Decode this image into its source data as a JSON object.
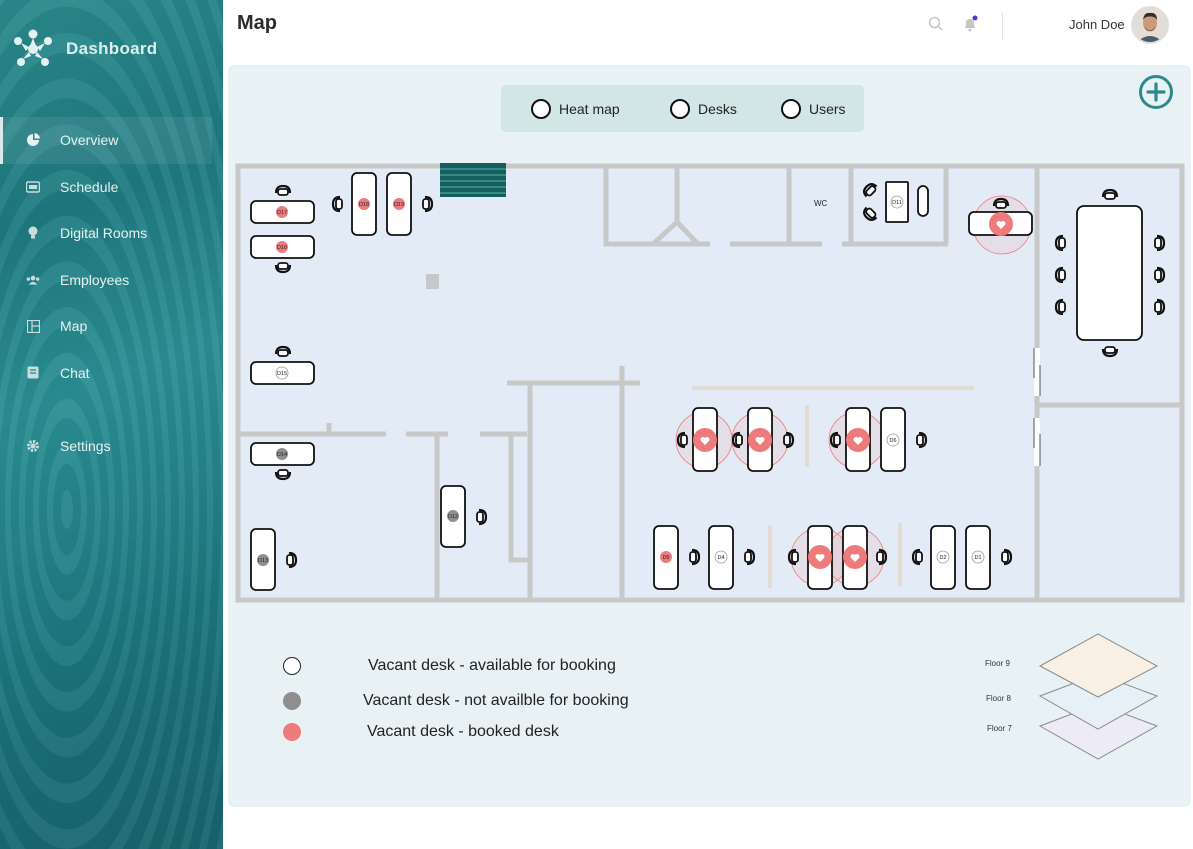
{
  "sidebar": {
    "brand": "Dashboard",
    "items": [
      {
        "label": "Overview",
        "icon": "pie-chart-icon"
      },
      {
        "label": "Schedule",
        "icon": "calendar-icon"
      },
      {
        "label": "Digital Rooms",
        "icon": "lightbulb-icon"
      },
      {
        "label": "Employees",
        "icon": "people-icon"
      },
      {
        "label": "Map",
        "icon": "map-icon"
      },
      {
        "label": "Chat",
        "icon": "chat-icon"
      }
    ],
    "settings_label": "Settings"
  },
  "header": {
    "title": "Map",
    "user_name": "John Doe"
  },
  "toggles": [
    {
      "label": "Heat map"
    },
    {
      "label": "Desks"
    },
    {
      "label": "Users"
    }
  ],
  "floorplan": {
    "wc_label": "WC",
    "desks": {
      "D1": "D1",
      "D2": "D2",
      "D4": "D4",
      "D5": "D5",
      "D6": "D6",
      "D11": "D11",
      "D12": "D12",
      "D13": "D13",
      "D14": "D14",
      "D15": "D15",
      "D16": "D16",
      "D17": "D17",
      "D18": "D18",
      "D19": "D19"
    }
  },
  "legend": [
    {
      "label": "Vacant desk - available for booking",
      "color": "#ffffff"
    },
    {
      "label": "Vacant desk - not availble for booking",
      "color": "#8f8f8f"
    },
    {
      "label": "Vacant desk - booked desk",
      "color": "#ee7b7b"
    }
  ],
  "floors": [
    {
      "label": "Floor 9",
      "color": "#f8efe5"
    },
    {
      "label": "Floor 8",
      "color": "#e6f0f7"
    },
    {
      "label": "Floor 7",
      "color": "#ecebf7"
    }
  ],
  "colors": {
    "accent": "#2c8a8a",
    "wall": "#c9c9c9",
    "booked": "#ee7b7b",
    "unavailable": "#8f8f8f"
  }
}
